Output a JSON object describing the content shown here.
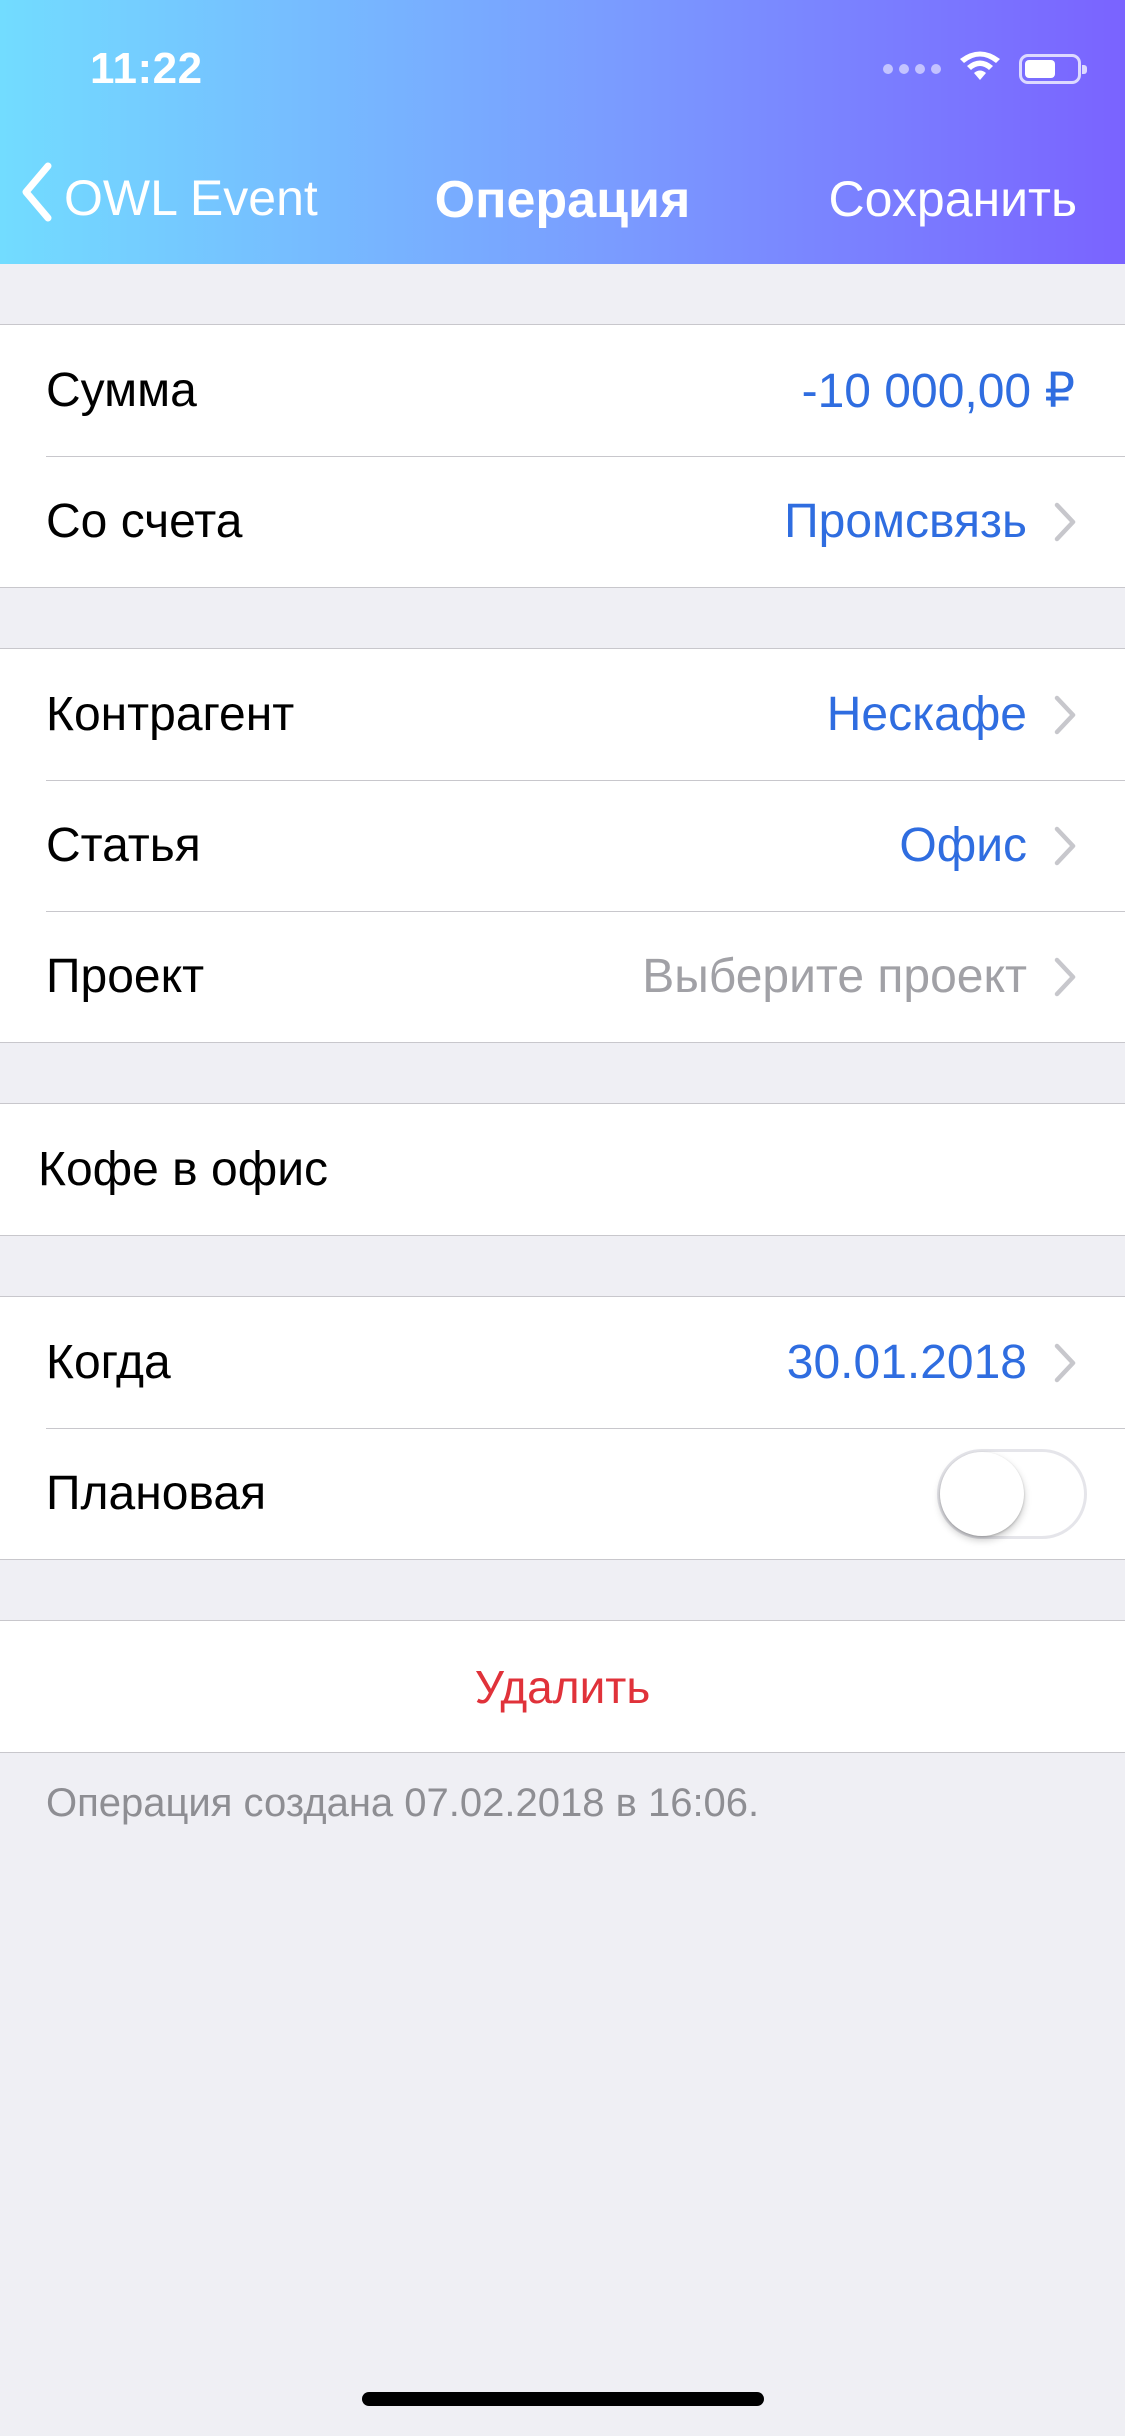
{
  "status_bar": {
    "time": "11:22",
    "signal_icon": "signal-dots-icon",
    "wifi_icon": "wifi-icon",
    "battery_icon": "battery-icon",
    "battery_level": 0.6
  },
  "nav": {
    "back_label": "OWL Event",
    "title": "Операция",
    "save_label": "Сохранить"
  },
  "amount_group": {
    "amount_label": "Сумма",
    "amount_value": "-10 000,00 ₽",
    "account_label": "Со счета",
    "account_value": "Промсвязь"
  },
  "details_group": {
    "counterparty_label": "Контрагент",
    "counterparty_value": "Нескафе",
    "category_label": "Статья",
    "category_value": "Офис",
    "project_label": "Проект",
    "project_placeholder": "Выберите проект"
  },
  "memo": {
    "text": "Кофе в офис"
  },
  "date_group": {
    "when_label": "Когда",
    "when_value": "30.01.2018",
    "planned_label": "Плановая",
    "planned_on": false
  },
  "actions": {
    "delete_label": "Удалить"
  },
  "footer": {
    "created_note": "Операция создана 07.02.2018 в 16:06."
  },
  "colors": {
    "accent_blue": "#2f6de0",
    "destructive_red": "#e0323a",
    "placeholder_gray": "#a1a1a6",
    "header_gradient_start": "#72dcff",
    "header_gradient_end": "#7a63ff"
  }
}
